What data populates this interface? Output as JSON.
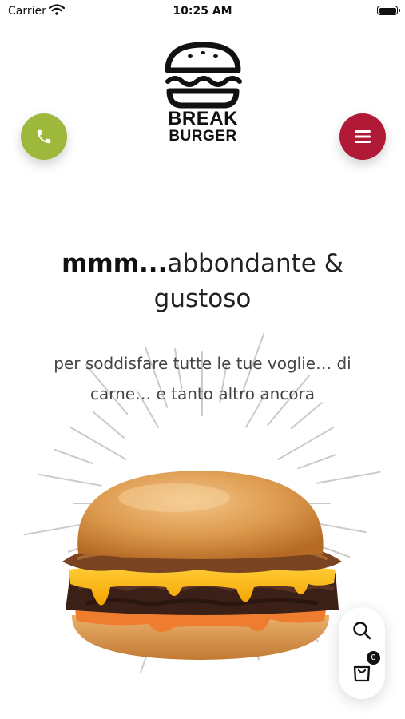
{
  "status_bar": {
    "carrier": "Carrier",
    "time": "10:25 AM"
  },
  "brand": {
    "name_line1": "BREAK",
    "name_line2": "BURGER"
  },
  "header": {
    "call_icon": "phone-icon",
    "menu_icon": "hamburger-menu-icon"
  },
  "hero": {
    "headline_bold": "mmm...",
    "headline_rest": "abbondante & gustoso",
    "subtitle": "per soddisfare tutte le tue voglie… di carne… e tanto altro ancora"
  },
  "actions": {
    "search_icon": "search-icon",
    "cart_icon": "shopping-bag-icon",
    "cart_count": "0"
  },
  "colors": {
    "call": "#9db83a",
    "menu": "#b01a37",
    "text": "#222222"
  }
}
